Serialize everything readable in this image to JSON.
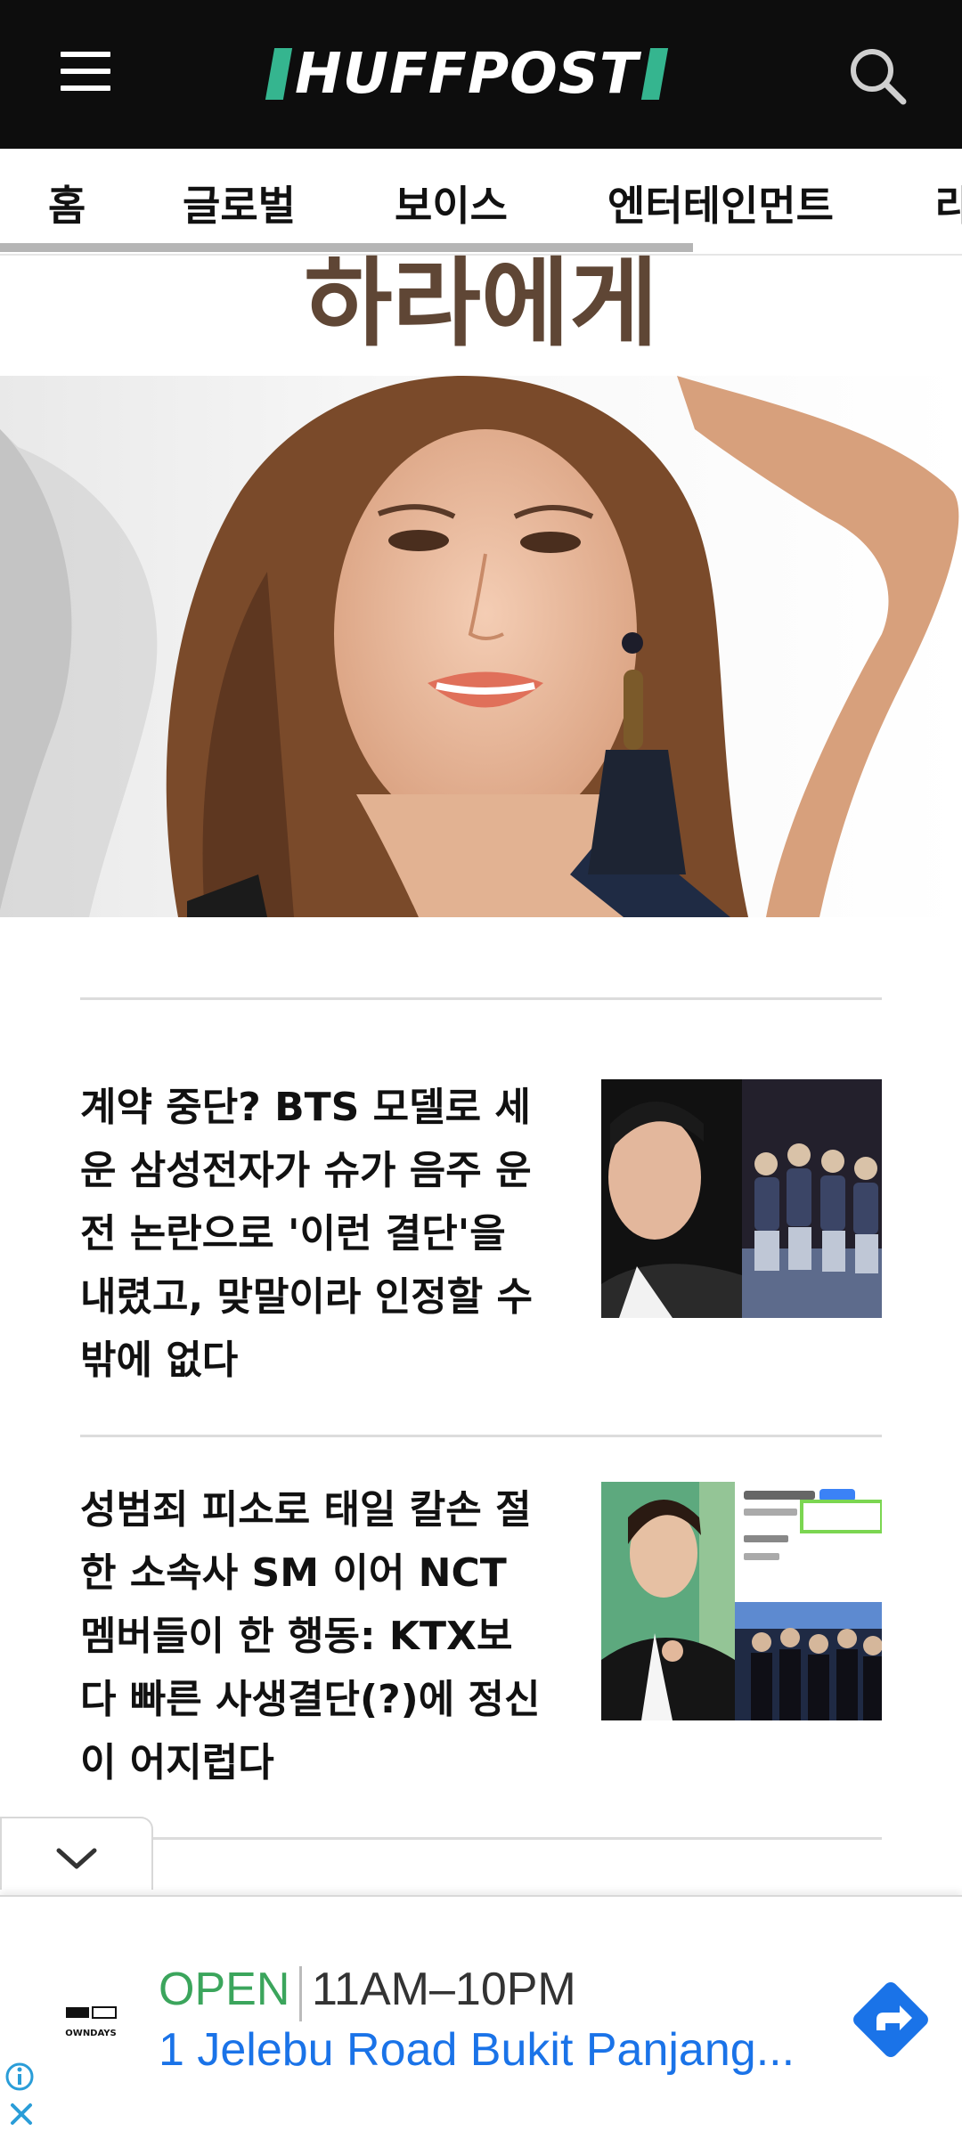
{
  "header": {
    "logo_text": "HUFFPOST",
    "brand_accent": "#35b58f",
    "menu_icon": "hamburger-menu-icon",
    "search_icon": "search-icon"
  },
  "tabs": [
    {
      "label": "홈"
    },
    {
      "label": "글로벌"
    },
    {
      "label": "보이스"
    },
    {
      "label": "엔터테인먼트"
    },
    {
      "label": "라"
    }
  ],
  "top_headline_fragment": "하라에게",
  "hero": {
    "icon": "photo-woman-portrait"
  },
  "articles": [
    {
      "title": "계약 중단? BTS 모델로 세운 삼성전자가 슈가 음주 운전 논란으로 '이런 결단'을 내렸고, 맞말이라 인정할 수 밖에 없다"
    },
    {
      "title": "성범죄 피소로 태일 칼손 절한 소속사 SM 이어 NCT 멤버들이 한 행동: KTX보다 빠른 사생결단(?)에 정신이 어지럽다"
    }
  ],
  "ad": {
    "brand_logo": "OWNDAYS",
    "status": "OPEN",
    "hours": "11AM–10PM",
    "address": "1 Jelebu Road Bukit Panjang...",
    "cta_icon": "directions-icon",
    "info_icon": "info-icon",
    "close_icon": "close-icon",
    "status_color": "#3ba55c",
    "link_color": "#1a73e8"
  },
  "collapse_icon": "chevron-down-icon"
}
